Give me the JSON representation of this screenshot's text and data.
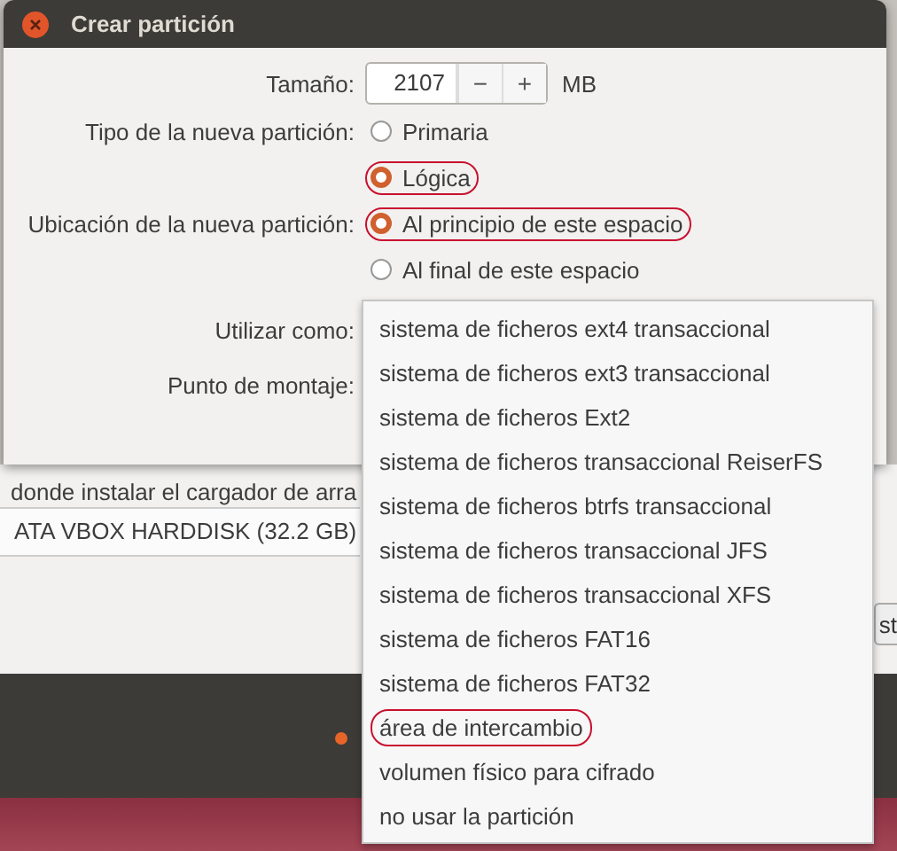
{
  "dialog": {
    "title": "Crear partición",
    "size": {
      "label": "Tamaño:",
      "value": "2107",
      "decrement": "−",
      "increment": "+",
      "unit": "MB"
    },
    "type": {
      "label": "Tipo de la nueva partición:",
      "options": [
        {
          "label": "Primaria",
          "selected": false,
          "annotated": false
        },
        {
          "label": "Lógica",
          "selected": true,
          "annotated": true
        }
      ]
    },
    "location": {
      "label": "Ubicación de la nueva partición:",
      "options": [
        {
          "label": "Al principio de este espacio",
          "selected": true,
          "annotated": true
        },
        {
          "label": "Al final de este espacio",
          "selected": false,
          "annotated": false
        }
      ]
    },
    "use_as": {
      "label": "Utilizar como:"
    },
    "mount_point": {
      "label": "Punto de montaje:"
    }
  },
  "dropdown_menu": {
    "items": [
      {
        "label": "sistema de ficheros ext4 transaccional",
        "annotated": false
      },
      {
        "label": "sistema de ficheros ext3 transaccional",
        "annotated": false
      },
      {
        "label": "sistema de ficheros Ext2",
        "annotated": false
      },
      {
        "label": "sistema de ficheros transaccional ReiserFS",
        "annotated": false
      },
      {
        "label": "sistema de ficheros btrfs transaccional",
        "annotated": false
      },
      {
        "label": "sistema de ficheros transaccional JFS",
        "annotated": false
      },
      {
        "label": "sistema de ficheros transaccional XFS",
        "annotated": false
      },
      {
        "label": "sistema de ficheros FAT16",
        "annotated": false
      },
      {
        "label": "sistema de ficheros FAT32",
        "annotated": false
      },
      {
        "label": "área de intercambio",
        "annotated": true
      },
      {
        "label": "volumen físico para cifrado",
        "annotated": false
      },
      {
        "label": "no usar la partición",
        "annotated": false
      }
    ]
  },
  "background_window": {
    "bootloader_label": "donde instalar el cargador de arra",
    "device": "ATA VBOX HARDDISK (32.2 GB)",
    "button": "st"
  }
}
